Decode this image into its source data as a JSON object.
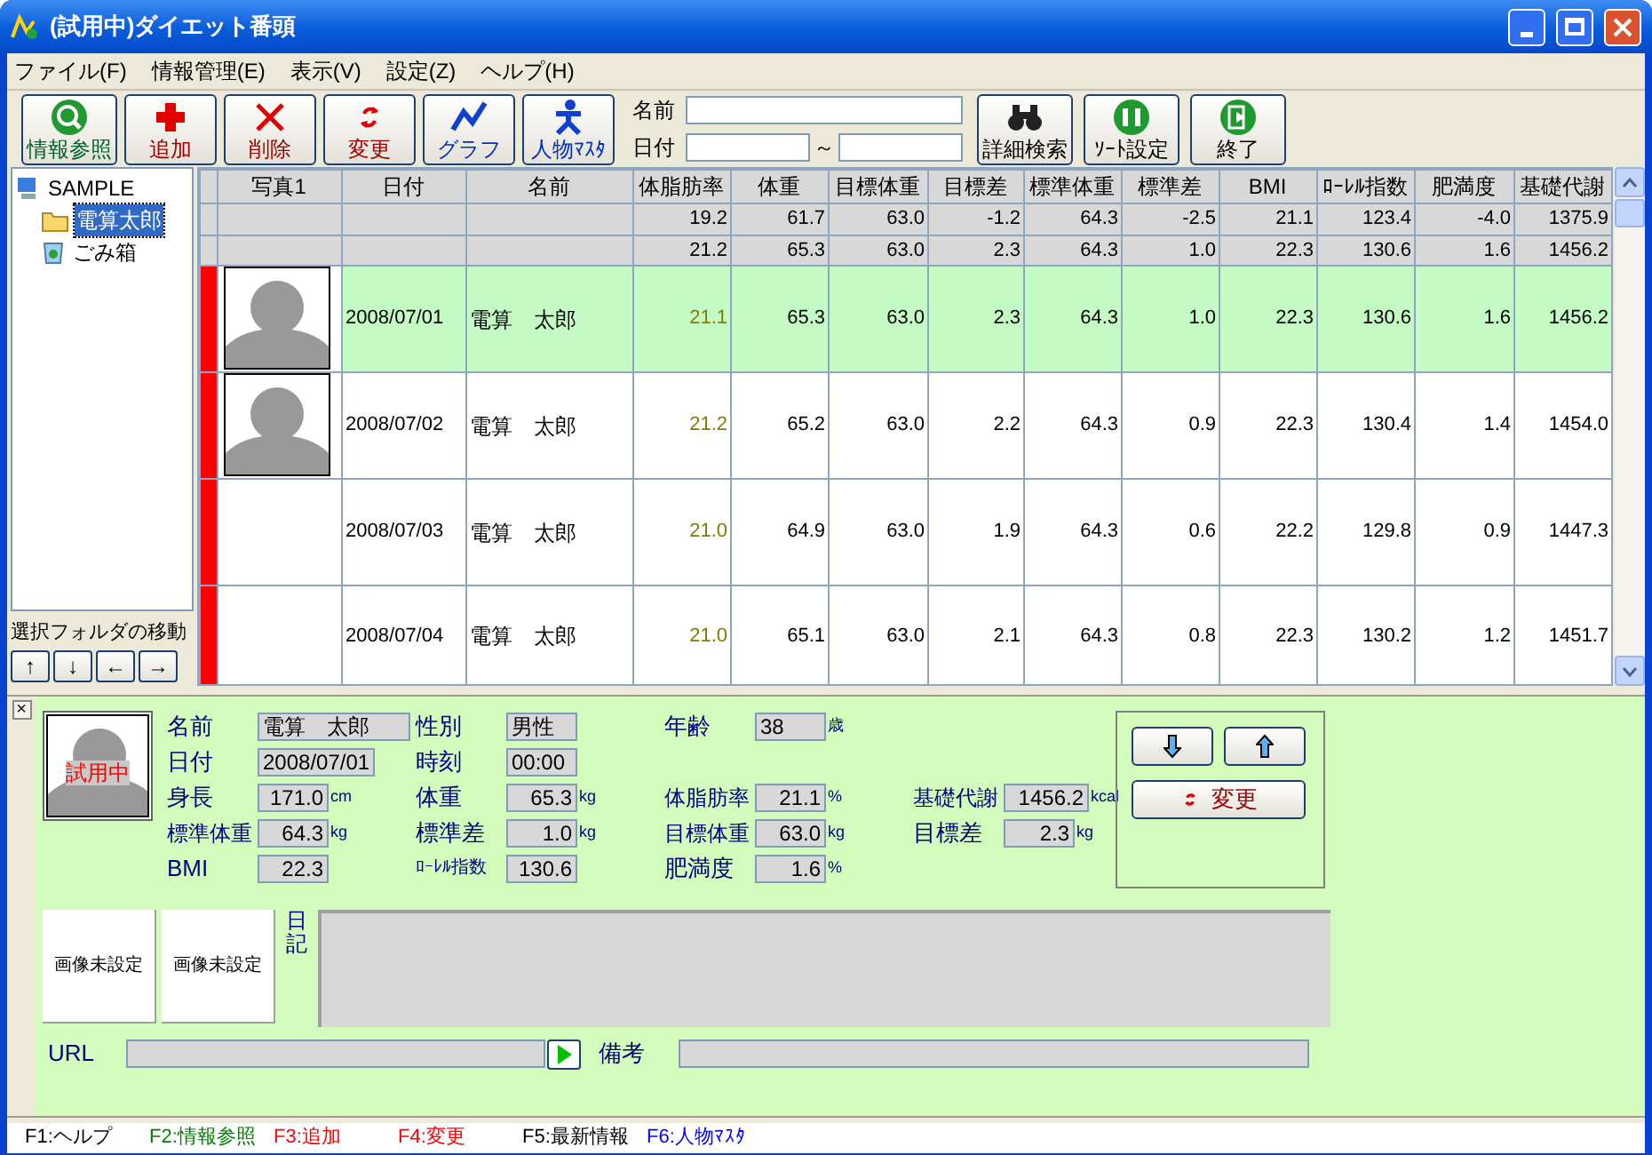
{
  "window": {
    "title": "(試用中)ダイエット番頭"
  },
  "menu": [
    "ファイル(F)",
    "情報管理(E)",
    "表示(V)",
    "設定(Z)",
    "ヘルプ(H)"
  ],
  "toolbar": {
    "left_buttons": [
      {
        "label": "情報参照",
        "kind": "view"
      },
      {
        "label": "追加",
        "kind": "add"
      },
      {
        "label": "削除",
        "kind": "delete"
      },
      {
        "label": "変更",
        "kind": "change"
      },
      {
        "label": "グラフ",
        "kind": "graph"
      },
      {
        "label": "人物ﾏｽﾀ",
        "kind": "person"
      }
    ],
    "search": {
      "name_label": "名前",
      "date_label": "日付",
      "range_separator": "～"
    },
    "right_buttons": [
      {
        "label": "詳細検索",
        "kind": "find"
      },
      {
        "label": "ｿｰﾄ設定",
        "kind": "sort"
      },
      {
        "label": "終了",
        "kind": "exit"
      }
    ]
  },
  "tree": {
    "label": "SAMPLE",
    "children": [
      {
        "label": "電算太郎",
        "kind": "folder",
        "selected": true
      },
      {
        "label": "ごみ箱",
        "kind": "trash",
        "selected": false
      }
    ]
  },
  "folder_move": {
    "label": "選択フォルダの移動",
    "buttons": [
      "↑",
      "↓",
      "←",
      "→"
    ]
  },
  "table": {
    "columns": [
      "",
      "写真1",
      "日付",
      "名前",
      "体脂肪率",
      "体重",
      "目標体重",
      "目標差",
      "標準体重",
      "標準差",
      "BMI",
      "ﾛｰﾚﾙ指数",
      "肥満度",
      "基礎代謝"
    ],
    "summary_rows": [
      [
        "",
        "",
        "",
        "",
        "19.2",
        "61.7",
        "63.0",
        "-1.2",
        "64.3",
        "-2.5",
        "21.1",
        "123.4",
        "-4.0",
        "1375.9"
      ],
      [
        "",
        "",
        "",
        "",
        "21.2",
        "65.3",
        "63.0",
        "2.3",
        "64.3",
        "1.0",
        "22.3",
        "130.6",
        "1.6",
        "1456.2"
      ]
    ],
    "rows": [
      {
        "selected": true,
        "marked": true,
        "photo": true,
        "cells": [
          "",
          "",
          "2008/07/01",
          "電算　太郎",
          "21.1",
          "65.3",
          "63.0",
          "2.3",
          "64.3",
          "1.0",
          "22.3",
          "130.6",
          "1.6",
          "1456.2"
        ]
      },
      {
        "selected": false,
        "marked": true,
        "photo": true,
        "cells": [
          "",
          "",
          "2008/07/02",
          "電算　太郎",
          "21.2",
          "65.2",
          "63.0",
          "2.2",
          "64.3",
          "0.9",
          "22.3",
          "130.4",
          "1.4",
          "1454.0"
        ]
      },
      {
        "selected": false,
        "marked": true,
        "photo": false,
        "cells": [
          "",
          "",
          "2008/07/03",
          "電算　太郎",
          "21.0",
          "64.9",
          "63.0",
          "1.9",
          "64.3",
          "0.6",
          "22.2",
          "129.8",
          "0.9",
          "1447.3"
        ]
      },
      {
        "selected": false,
        "marked": true,
        "photo": false,
        "cells": [
          "",
          "",
          "2008/07/04",
          "電算　太郎",
          "21.0",
          "65.1",
          "63.0",
          "2.1",
          "64.3",
          "0.8",
          "22.3",
          "130.2",
          "1.2",
          "1451.7"
        ]
      }
    ]
  },
  "detail": {
    "close": "×",
    "badge": "試用中",
    "rows": [
      [
        {
          "label": "名前",
          "value": "電算　太郎",
          "kind": "wide"
        },
        {
          "label": "性別",
          "value": "男性",
          "kind": "text"
        },
        {
          "label": "年齢",
          "value": "38",
          "kind": "text",
          "unit": "歳"
        }
      ],
      [
        {
          "label": "日付",
          "value": "2008/07/01",
          "kind": "text"
        },
        {
          "label": "時刻",
          "value": "00:00",
          "kind": "text"
        }
      ],
      [
        {
          "label": "身長",
          "value": "171.0",
          "kind": "number",
          "unit": "cm"
        },
        {
          "label": "体重",
          "value": "65.3",
          "kind": "number",
          "unit": "kg"
        },
        {
          "label": "体脂肪率",
          "value": "21.1",
          "kind": "number",
          "unit": "%"
        },
        {
          "label": "基礎代謝",
          "value": "1456.2",
          "kind": "number",
          "unit": "kcal"
        }
      ],
      [
        {
          "label": "標準体重",
          "value": "64.3",
          "kind": "number",
          "unit": "kg"
        },
        {
          "label": "標準差",
          "value": "1.0",
          "kind": "number",
          "unit": "kg"
        },
        {
          "label": "目標体重",
          "value": "63.0",
          "kind": "number",
          "unit": "kg"
        },
        {
          "label": "目標差",
          "value": "2.3",
          "kind": "number",
          "unit": "kg"
        }
      ],
      [
        {
          "label": "BMI",
          "value": "22.3",
          "kind": "number"
        },
        {
          "label": "ﾛｰﾚﾙ指数",
          "value": "130.6",
          "kind": "number"
        },
        {
          "label": "肥満度",
          "value": "1.6",
          "kind": "number",
          "unit": "%"
        }
      ]
    ],
    "change_button": "変更",
    "images": [
      "画像未設定",
      "画像未設定"
    ],
    "diary_label": "日記",
    "url_label": "URL",
    "note_label": "備考"
  },
  "status_bar": [
    {
      "label": "F1:ヘルプ",
      "color": "#000000"
    },
    {
      "label": "F2:情報参照",
      "color": "#008000"
    },
    {
      "label": "F3:追加",
      "color": "#ff0000"
    },
    {
      "label": "F4:変更",
      "color": "#ff0000"
    },
    {
      "label": "F5:最新情報",
      "color": "#000000"
    },
    {
      "label": "F6:人物ﾏｽﾀ",
      "color": "#0000ff"
    }
  ]
}
